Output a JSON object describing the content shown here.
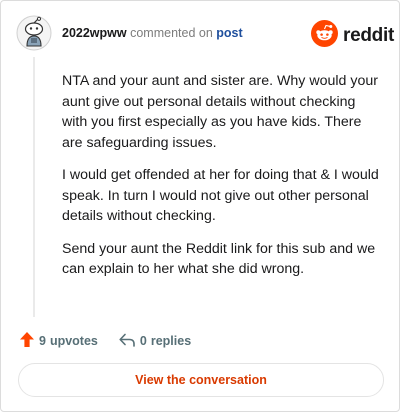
{
  "header": {
    "username": "2022wpww",
    "action_text": "commented on",
    "post_link": "post",
    "brand_word": "reddit"
  },
  "comment": {
    "paragraphs": [
      "NTA and your aunt and sister are. Why would your aunt give out personal details without checking with you first especially as you have kids. There are safeguarding issues.",
      "I would get offended at her for doing that & I would speak. In turn I would not give out other personal details without checking.",
      "Send your aunt the Reddit link for this sub and we can explain to her what she did wrong."
    ]
  },
  "footer": {
    "upvotes_count": "9",
    "upvotes_label": "upvotes",
    "replies_count": "0",
    "replies_label": "replies",
    "view_button_label": "View the conversation"
  },
  "colors": {
    "accent": "#d93a00",
    "upvote_arrow": "#ff4500",
    "link": "#1f4f9d"
  },
  "icons": {
    "avatar": "snoo-avatar-icon",
    "brand": "reddit-logo-icon",
    "upvote": "upvote-arrow-icon",
    "reply": "reply-arrow-icon"
  }
}
